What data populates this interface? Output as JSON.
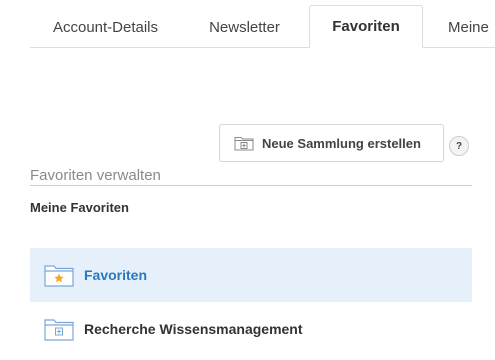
{
  "tabs": [
    {
      "label": "Account-Details"
    },
    {
      "label": "Newsletter"
    },
    {
      "label": "Favoriten",
      "active": true
    },
    {
      "label": "Meine"
    }
  ],
  "toolbar": {
    "new_collection_label": "Neue Sammlung erstellen",
    "help_label": "?"
  },
  "manage": {
    "title": "Favoriten verwalten",
    "subtitle": "Meine Favoriten"
  },
  "collections": [
    {
      "label": "Favoriten",
      "icon": "star-folder-icon",
      "selected": true
    },
    {
      "label": "Recherche Wissensmanagement",
      "icon": "folder-icon",
      "selected": false
    }
  ],
  "colors": {
    "accent": "#2a79bf",
    "selected_bg": "#e6f0fa",
    "star": "#f5a623",
    "folder": "#7aa7d6"
  }
}
